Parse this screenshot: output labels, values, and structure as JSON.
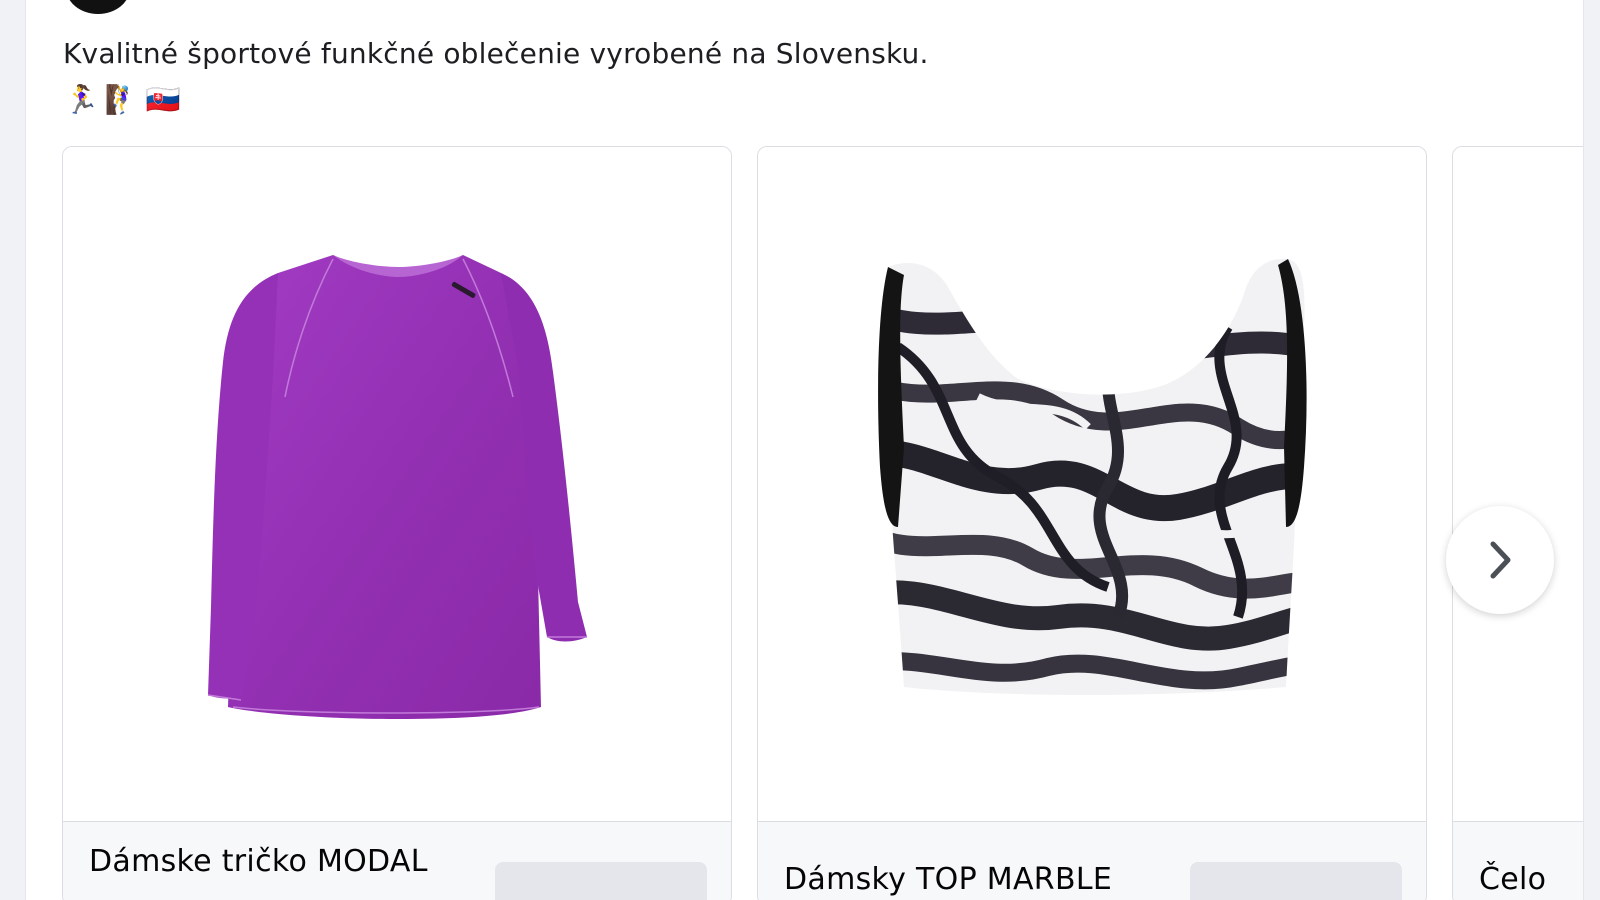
{
  "post": {
    "text": "Kvalitné športové funkčné oblečenie vyrobené na Slovensku.",
    "emojis": [
      "🏃‍♀️",
      "🧗‍♀️",
      "🇸🇰"
    ],
    "author_name": ""
  },
  "carousel": {
    "cards": [
      {
        "title": "Dámske tričko MODAL",
        "image": "purple-long-sleeve-shirt",
        "cta_label": ""
      },
      {
        "title": "Dámsky TOP MARBLE",
        "image": "black-white-marble-sports-top",
        "cta_label": ""
      },
      {
        "title": "Čelo",
        "image": "",
        "cta_label": ""
      }
    ],
    "next_icon": "chevron-right-icon"
  },
  "colors": {
    "page_bg": "#f0f2f5",
    "card_border": "#dadde1",
    "cta_bg": "#e4e6eb",
    "shirt_purple": "#9b32b8"
  }
}
